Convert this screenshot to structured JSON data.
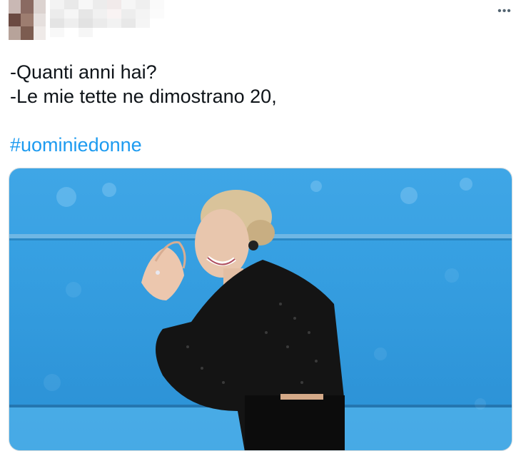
{
  "tweet": {
    "more_icon": "more-horizontal-icon",
    "more_label": "•••",
    "text_lines": [
      "-Quanti anni hai?",
      "-Le mie tette ne dimostrano 20,"
    ],
    "hashtag": "#uominiedonne"
  },
  "colors": {
    "text": "#0f1419",
    "link": "#1d9bf0",
    "muted": "#536471",
    "backdrop_blue": "#2e9de3"
  },
  "media": {
    "type": "photo"
  }
}
